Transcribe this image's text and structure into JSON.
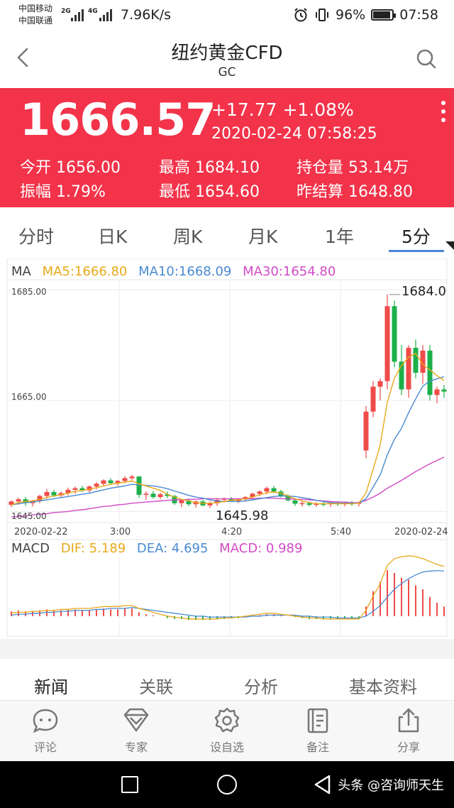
{
  "status_bar": {
    "carrier1": "中国移动",
    "carrier2": "中国联通",
    "net1": "2G",
    "net2": "4G",
    "speed": "7.96K/s",
    "battery": "96%",
    "time": "07:58"
  },
  "header": {
    "title": "纽约黄金CFD",
    "subtitle": "GC"
  },
  "quote": {
    "price": "1666.57",
    "change": "+17.77  +1.08%",
    "time": "2020-02-24 07:58:25",
    "stats": [
      {
        "label": "今开",
        "value": "1656.00"
      },
      {
        "label": "最高",
        "value": "1684.10"
      },
      {
        "label": "持仓量",
        "value": "53.14万"
      },
      {
        "label": "振幅",
        "value": "1.79%"
      },
      {
        "label": "最低",
        "value": "1654.60"
      },
      {
        "label": "昨结算",
        "value": "1648.80"
      }
    ]
  },
  "period_tabs": [
    "分时",
    "日K",
    "周K",
    "月K",
    "1年",
    "5分"
  ],
  "active_period": "5分",
  "chart_data": {
    "type": "candlestick",
    "ma_label": "MA",
    "ma5": "MA5:1666.80",
    "ma10": "MA10:1668.09",
    "ma30": "MA30:1654.80",
    "y_ticks": [
      "1685.00",
      "1665.00",
      "1645.00"
    ],
    "x_ticks": [
      "2020-02-22",
      "3:00",
      "4:20",
      "5:40",
      "2020-02-24"
    ],
    "high_label": "1684.0",
    "low_label": "1645.98",
    "ylim": [
      1643,
      1686
    ],
    "candles": [
      [
        1646.2,
        1647.0,
        1645.8,
        1646.8
      ],
      [
        1646.8,
        1647.5,
        1646.2,
        1647.2
      ],
      [
        1647.2,
        1647.6,
        1646.0,
        1646.5
      ],
      [
        1646.5,
        1647.1,
        1645.9,
        1646.9
      ],
      [
        1646.9,
        1648.0,
        1646.5,
        1647.8
      ],
      [
        1647.8,
        1649.0,
        1647.3,
        1648.5
      ],
      [
        1648.5,
        1648.9,
        1647.6,
        1647.9
      ],
      [
        1647.9,
        1648.6,
        1647.4,
        1648.3
      ],
      [
        1648.3,
        1649.3,
        1647.9,
        1648.9
      ],
      [
        1648.9,
        1649.5,
        1648.2,
        1649.2
      ],
      [
        1649.2,
        1649.6,
        1648.5,
        1648.8
      ],
      [
        1648.8,
        1649.7,
        1648.4,
        1649.5
      ],
      [
        1649.5,
        1650.3,
        1649.0,
        1650.0
      ],
      [
        1650.0,
        1650.8,
        1649.5,
        1650.6
      ],
      [
        1650.6,
        1651.0,
        1649.8,
        1650.1
      ],
      [
        1650.1,
        1650.7,
        1649.6,
        1650.5
      ],
      [
        1650.5,
        1651.4,
        1650.1,
        1651.0
      ],
      [
        1651.0,
        1651.6,
        1650.6,
        1651.3
      ],
      [
        1651.3,
        1651.4,
        1647.5,
        1648.0
      ],
      [
        1648.0,
        1648.6,
        1647.1,
        1648.2
      ],
      [
        1648.2,
        1648.7,
        1647.3,
        1647.6
      ],
      [
        1647.6,
        1648.4,
        1647.2,
        1648.1
      ],
      [
        1648.1,
        1648.6,
        1647.4,
        1647.8
      ],
      [
        1647.8,
        1648.0,
        1646.2,
        1646.5
      ],
      [
        1646.5,
        1647.2,
        1645.8,
        1647.0
      ],
      [
        1647.0,
        1647.3,
        1646.0,
        1646.3
      ],
      [
        1646.3,
        1647.0,
        1645.7,
        1646.8
      ],
      [
        1646.8,
        1647.1,
        1645.9,
        1646.1
      ],
      [
        1646.1,
        1646.8,
        1645.6,
        1646.5
      ],
      [
        1646.5,
        1647.3,
        1646.0,
        1647.1
      ],
      [
        1647.1,
        1647.5,
        1646.6,
        1647.3
      ],
      [
        1647.3,
        1647.6,
        1646.7,
        1646.9
      ],
      [
        1646.9,
        1647.4,
        1646.5,
        1647.2
      ],
      [
        1647.2,
        1647.8,
        1646.8,
        1647.6
      ],
      [
        1647.6,
        1648.4,
        1647.2,
        1648.2
      ],
      [
        1648.2,
        1648.8,
        1647.8,
        1648.6
      ],
      [
        1648.6,
        1649.5,
        1648.1,
        1649.2
      ],
      [
        1649.2,
        1649.6,
        1648.3,
        1648.6
      ],
      [
        1648.6,
        1648.9,
        1647.5,
        1647.8
      ],
      [
        1647.8,
        1648.1,
        1646.8,
        1647.0
      ],
      [
        1647.0,
        1647.3,
        1646.0,
        1646.4
      ],
      [
        1646.4,
        1646.9,
        1645.9,
        1646.5
      ],
      [
        1646.5,
        1646.8,
        1645.9,
        1646.2
      ],
      [
        1646.2,
        1646.7,
        1645.8,
        1646.4
      ],
      [
        1646.4,
        1646.8,
        1645.9,
        1646.3
      ],
      [
        1646.3,
        1646.7,
        1645.8,
        1646.5
      ],
      [
        1646.5,
        1646.9,
        1646.0,
        1646.3
      ],
      [
        1646.3,
        1646.7,
        1645.9,
        1646.5
      ],
      [
        1646.5,
        1646.9,
        1646.0,
        1646.4
      ],
      [
        1646.4,
        1646.8,
        1645.9,
        1646.6
      ],
      [
        1656.0,
        1664.0,
        1654.6,
        1663.0
      ],
      [
        1663.0,
        1668.5,
        1662.0,
        1667.5
      ],
      [
        1667.5,
        1669.0,
        1665.0,
        1668.5
      ],
      [
        1668.5,
        1684.1,
        1667.0,
        1682.0
      ],
      [
        1682.0,
        1683.0,
        1671.0,
        1672.0
      ],
      [
        1672.0,
        1675.0,
        1666.0,
        1667.0
      ],
      [
        1667.0,
        1675.0,
        1665.5,
        1674.5
      ],
      [
        1674.5,
        1676.0,
        1669.0,
        1670.0
      ],
      [
        1670.0,
        1675.0,
        1668.0,
        1674.0
      ],
      [
        1674.0,
        1675.0,
        1665.0,
        1666.0
      ],
      [
        1666.0,
        1667.5,
        1664.5,
        1667.0
      ],
      [
        1667.0,
        1667.8,
        1665.5,
        1666.6
      ]
    ],
    "ma5_series": [
      1646.2,
      1646.6,
      1646.8,
      1646.9,
      1647.2,
      1647.5,
      1647.8,
      1648.0,
      1648.3,
      1648.6,
      1648.8,
      1649.0,
      1649.3,
      1649.6,
      1649.9,
      1650.1,
      1650.3,
      1650.5,
      1650.0,
      1649.6,
      1649.2,
      1648.8,
      1648.1,
      1647.6,
      1647.2,
      1646.9,
      1646.6,
      1646.5,
      1646.5,
      1646.6,
      1646.8,
      1647.0,
      1647.1,
      1647.3,
      1647.6,
      1648.0,
      1648.4,
      1648.5,
      1648.3,
      1647.8,
      1647.3,
      1646.9,
      1646.6,
      1646.4,
      1646.4,
      1646.4,
      1646.4,
      1646.4,
      1646.4,
      1646.5,
      1648.4,
      1652.6,
      1657.0,
      1664.7,
      1669.0,
      1671.3,
      1672.8,
      1673.5,
      1671.5,
      1670.5,
      1669.5,
      1668.6
    ],
    "ma10_series": [
      1646.2,
      1646.4,
      1646.6,
      1646.7,
      1646.9,
      1647.1,
      1647.3,
      1647.5,
      1647.7,
      1647.9,
      1648.1,
      1648.3,
      1648.6,
      1648.9,
      1649.2,
      1649.4,
      1649.6,
      1649.9,
      1649.8,
      1649.7,
      1649.6,
      1649.4,
      1649.1,
      1648.7,
      1648.3,
      1647.9,
      1647.6,
      1647.4,
      1647.1,
      1646.9,
      1646.8,
      1646.8,
      1646.8,
      1646.9,
      1647.1,
      1647.3,
      1647.5,
      1647.7,
      1647.8,
      1647.8,
      1647.7,
      1647.5,
      1647.3,
      1647.0,
      1646.8,
      1646.6,
      1646.5,
      1646.5,
      1646.5,
      1646.5,
      1647.3,
      1649.4,
      1651.6,
      1655.2,
      1658.0,
      1660.0,
      1662.8,
      1665.3,
      1667.6,
      1668.5,
      1668.9,
      1669.3
    ],
    "ma30_series": [
      1644.0,
      1644.1,
      1644.2,
      1644.4,
      1644.5,
      1644.6,
      1644.8,
      1644.9,
      1645.0,
      1645.2,
      1645.3,
      1645.5,
      1645.7,
      1645.9,
      1646.0,
      1646.2,
      1646.3,
      1646.5,
      1646.6,
      1646.7,
      1646.8,
      1646.9,
      1647.0,
      1647.1,
      1647.1,
      1647.2,
      1647.2,
      1647.3,
      1647.3,
      1647.3,
      1647.3,
      1647.3,
      1647.3,
      1647.3,
      1647.3,
      1647.4,
      1647.4,
      1647.4,
      1647.3,
      1647.3,
      1647.2,
      1647.2,
      1647.1,
      1647.0,
      1646.9,
      1646.8,
      1646.7,
      1646.7,
      1646.6,
      1646.6,
      1647.0,
      1647.6,
      1648.3,
      1649.2,
      1649.9,
      1650.6,
      1651.4,
      1652.2,
      1652.9,
      1653.6,
      1654.2,
      1654.8
    ],
    "macd": {
      "dif_label": "DIF: 5.189",
      "dea_label": "DEA: 4.695",
      "macd_label": "MACD: 0.989",
      "ylim": [
        -1.5,
        6.5
      ],
      "hist": [
        0.5,
        0.6,
        0.5,
        0.5,
        0.6,
        0.7,
        0.6,
        0.6,
        0.7,
        0.7,
        0.6,
        0.6,
        0.7,
        0.8,
        0.7,
        0.7,
        0.8,
        0.8,
        0.4,
        0.2,
        0.1,
        0.0,
        -0.2,
        -0.3,
        -0.3,
        -0.4,
        -0.4,
        -0.4,
        -0.4,
        -0.3,
        -0.3,
        -0.2,
        -0.2,
        -0.1,
        0.0,
        0.1,
        0.2,
        0.2,
        0.1,
        0.0,
        -0.1,
        -0.2,
        -0.3,
        -0.3,
        -0.3,
        -0.3,
        -0.3,
        -0.2,
        -0.2,
        -0.2,
        1.0,
        2.6,
        3.6,
        4.8,
        4.5,
        4.0,
        3.8,
        3.2,
        2.8,
        2.0,
        1.4,
        0.99
      ],
      "dif": [
        0.3,
        0.4,
        0.4,
        0.5,
        0.5,
        0.6,
        0.6,
        0.7,
        0.7,
        0.8,
        0.8,
        0.8,
        0.9,
        1.0,
        1.0,
        1.0,
        1.1,
        1.1,
        0.8,
        0.6,
        0.4,
        0.2,
        0.0,
        -0.1,
        -0.2,
        -0.3,
        -0.3,
        -0.3,
        -0.3,
        -0.3,
        -0.2,
        -0.2,
        -0.1,
        0.0,
        0.1,
        0.2,
        0.3,
        0.3,
        0.2,
        0.1,
        0.0,
        -0.1,
        -0.2,
        -0.2,
        -0.3,
        -0.3,
        -0.3,
        -0.3,
        -0.3,
        -0.3,
        0.6,
        2.1,
        3.4,
        5.3,
        6.0,
        6.2,
        6.3,
        6.2,
        6.0,
        5.7,
        5.4,
        5.19
      ],
      "dea": [
        0.1,
        0.2,
        0.2,
        0.3,
        0.3,
        0.4,
        0.4,
        0.5,
        0.5,
        0.6,
        0.6,
        0.6,
        0.7,
        0.7,
        0.8,
        0.8,
        0.8,
        0.9,
        0.8,
        0.7,
        0.6,
        0.5,
        0.4,
        0.3,
        0.2,
        0.1,
        0.0,
        0.0,
        -0.1,
        -0.1,
        -0.1,
        -0.1,
        -0.1,
        -0.1,
        0.0,
        0.0,
        0.1,
        0.1,
        0.1,
        0.1,
        0.1,
        0.0,
        0.0,
        -0.1,
        -0.1,
        -0.1,
        -0.2,
        -0.2,
        -0.2,
        -0.2,
        0.0,
        0.5,
        1.1,
        2.0,
        2.8,
        3.4,
        3.9,
        4.3,
        4.6,
        4.7,
        4.75,
        4.695
      ]
    }
  },
  "content_tabs": [
    "新闻",
    "关联",
    "分析",
    "基本资料"
  ],
  "actions": [
    {
      "label": "评论",
      "icon": "comment-icon"
    },
    {
      "label": "专家",
      "icon": "diamond-icon"
    },
    {
      "label": "设自选",
      "icon": "gear-icon"
    },
    {
      "label": "备注",
      "icon": "note-icon"
    },
    {
      "label": "分享",
      "icon": "share-icon"
    }
  ],
  "watermark": "头条 @咨询师天生",
  "colors": {
    "up": "#ef4b48",
    "down": "#1db04a",
    "ma5": "#e8a91a",
    "ma10": "#4a8ad0",
    "ma30": "#d24bc6",
    "quote_bg": "#f2334a"
  }
}
